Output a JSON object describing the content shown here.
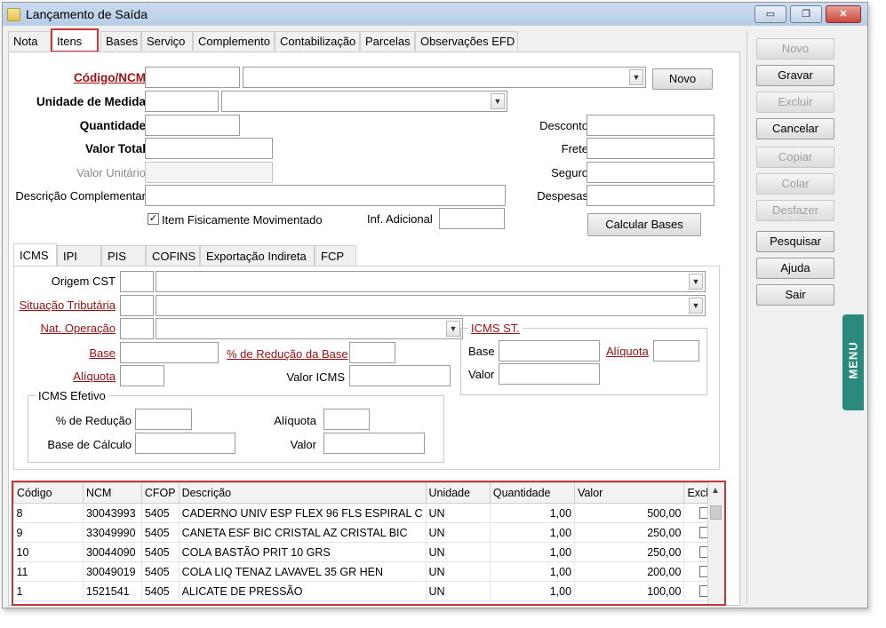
{
  "window": {
    "title": "Lançamento de Saída",
    "controls": {
      "minimize": "▭",
      "restore": "❐",
      "close": "✕"
    }
  },
  "main_tabs": [
    "Nota",
    "Itens",
    "Bases",
    "Serviço",
    "Complemento",
    "Contabilização",
    "Parcelas",
    "Observações EFD"
  ],
  "item_form": {
    "codigo_ncm_label": "Código/NCM",
    "novo_button": "Novo",
    "unidade_label": "Unidade de Medida",
    "quantidade_label": "Quantidade",
    "valor_total_label": "Valor Total",
    "valor_unitario_label": "Valor Unitário",
    "descricao_label": "Descrição Complementar",
    "desconto_label": "Desconto",
    "frete_label": "Frete",
    "seguro_label": "Seguro",
    "despesas_label": "Despesas",
    "item_fisico_label": "Item Fisicamente Movimentado",
    "item_fisico_checked": "✓",
    "inf_adicional_label": "Inf. Adicional",
    "calcular_button": "Calcular Bases"
  },
  "tax_tabs": [
    "ICMS",
    "IPI",
    "PIS",
    "COFINS",
    "Exportação Indireta",
    "FCP"
  ],
  "icms": {
    "origem_label": "Origem CST",
    "situacao_label": "Situação Tributária",
    "nat_operacao_label": "Nat. Operação",
    "base_label": "Base",
    "reducao_base_label": "% de Redução da Base",
    "aliquota_label": "Alíquota",
    "valor_icms_label": "Valor ICMS",
    "st_title": "ICMS ST.",
    "st_base_label": "Base",
    "st_aliquota_label": "Alíquota",
    "st_valor_label": "Valor",
    "efetivo_title": "ICMS Efetivo",
    "efetivo_reducao_label": "% de Redução",
    "efetivo_aliquota_label": "Alíquota",
    "efetivo_base_label": "Base de Cálculo",
    "efetivo_valor_label": "Valor"
  },
  "grid": {
    "columns": [
      "Código",
      "NCM",
      "CFOP",
      "Descrição",
      "Unidade",
      "Quantidade",
      "Valor",
      "Excluir"
    ],
    "rows": [
      {
        "codigo": "8",
        "ncm": "30043993",
        "cfop": "5405",
        "descricao": "CADERNO UNIV ESP FLEX 96 FLS ESPIRAL C",
        "unidade": "UN",
        "quantidade": "1,00",
        "valor": "500,00"
      },
      {
        "codigo": "9",
        "ncm": "33049990",
        "cfop": "5405",
        "descricao": "CANETA ESF BIC CRISTAL AZ CRISTAL BIC",
        "unidade": "UN",
        "quantidade": "1,00",
        "valor": "250,00"
      },
      {
        "codigo": "10",
        "ncm": "30044090",
        "cfop": "5405",
        "descricao": "COLA BASTÃO PRIT 10 GRS",
        "unidade": "UN",
        "quantidade": "1,00",
        "valor": "250,00"
      },
      {
        "codigo": "11",
        "ncm": "30049019",
        "cfop": "5405",
        "descricao": "COLA LIQ TENAZ LAVAVEL 35 GR HEN",
        "unidade": "UN",
        "quantidade": "1,00",
        "valor": "200,00"
      },
      {
        "codigo": "1",
        "ncm": "1521541",
        "cfop": "5405",
        "descricao": "ALICATE DE PRESSÃO",
        "unidade": "UN",
        "quantidade": "1,00",
        "valor": "100,00"
      }
    ]
  },
  "actions": [
    "Novo",
    "Gravar",
    "Excluir",
    "Cancelar",
    "Copiar",
    "Colar",
    "Desfazer",
    "Pesquisar",
    "Ajuda",
    "Sair"
  ],
  "menu_tab": "MENU",
  "colors": {
    "accent_red": "#d8343a",
    "menu_teal": "#2a8a7e",
    "required_label": "#a01010"
  }
}
